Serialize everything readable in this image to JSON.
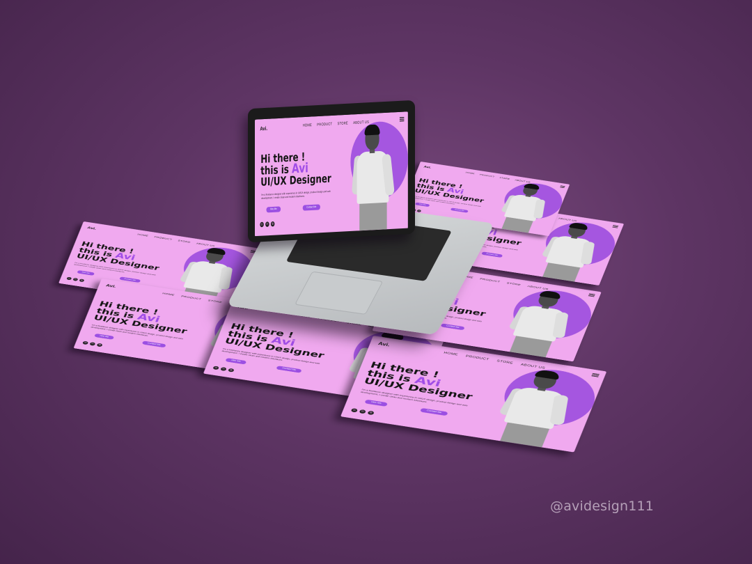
{
  "site": {
    "logo": "Avi.",
    "nav": [
      "HOME",
      "PRODUCT",
      "STORE",
      "ABOUT US"
    ],
    "headline_1": "Hi there !",
    "headline_2a": "this is",
    "headline_2b": "Avi",
    "headline_3": "UI/UX Designer",
    "description": "I'm a freelance designer with experience in UI/UX design, product design and web development. I create clean and modern interfaces.",
    "hire_label": "Hire Me",
    "contact_label": "Contact Me",
    "socials": [
      "ig",
      "in",
      "dr"
    ]
  },
  "watermark": "@avidesign111",
  "colors": {
    "card_bg": "#f0a9ef",
    "accent": "#a556e0",
    "background": "#5e3564"
  }
}
